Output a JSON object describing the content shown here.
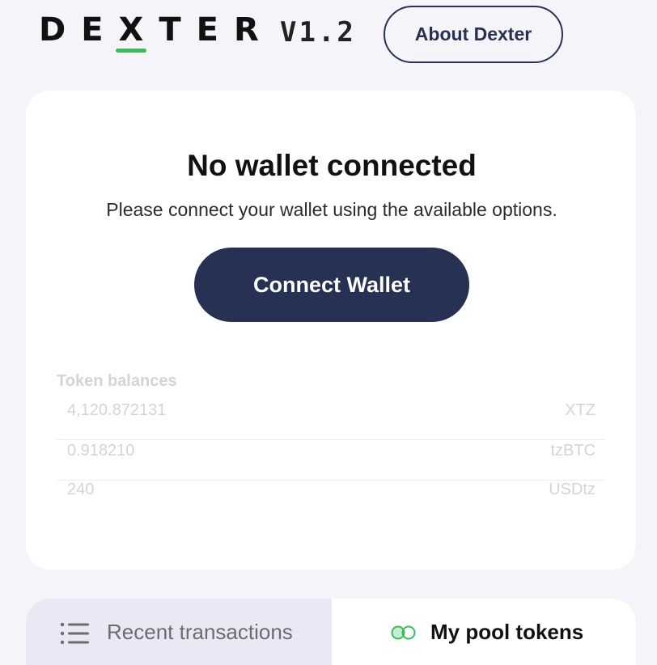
{
  "header": {
    "logo_text": "DEXTER",
    "version": "V1.2",
    "about_label": "About Dexter"
  },
  "wallet": {
    "title": "No wallet connected",
    "description": "Please connect your wallet using the available options.",
    "connect_label": "Connect Wallet"
  },
  "balances": {
    "label": "Token balances",
    "rows": [
      {
        "amount": "4,120.872131",
        "token": "XTZ"
      },
      {
        "amount": "0.918210",
        "token": "tzBTC"
      },
      {
        "amount": "240",
        "token": "USDtz"
      }
    ]
  },
  "tabs": {
    "recent_label": "Recent transactions",
    "recent_icon": "list-icon",
    "pool_label": "My pool tokens",
    "pool_icon": "pool-tokens-icon",
    "active": "My pool tokens"
  },
  "colors": {
    "background": "#f4f4f9",
    "primary": "#263154",
    "accent": "#3dbb5c",
    "muted_text": "#d4d4d8",
    "inactive_tab": "#e9e9f6"
  }
}
